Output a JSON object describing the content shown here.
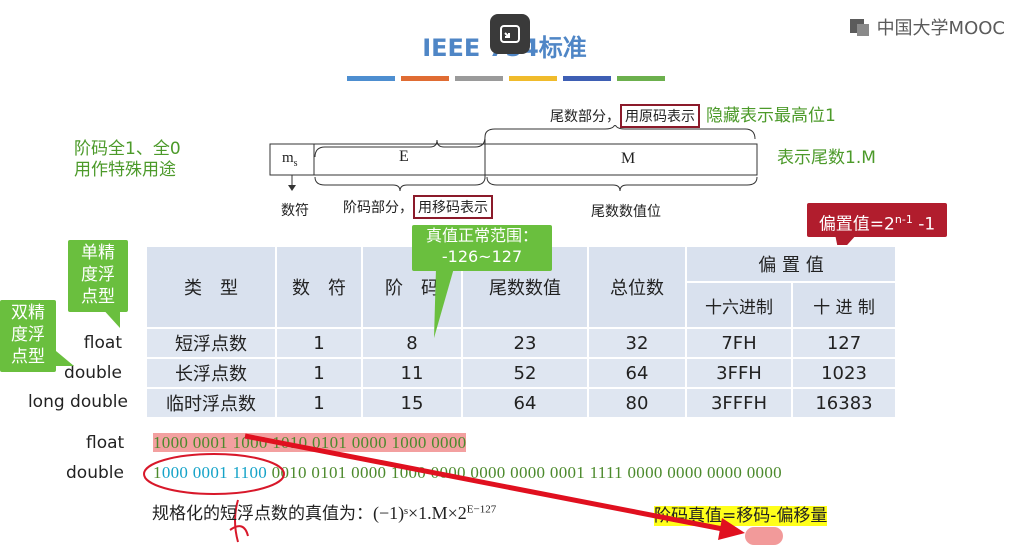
{
  "slide": {
    "title": "IEEE 754标准",
    "brand": "中国大学MOOC",
    "colorbars": [
      "#4d8ed0",
      "#e06c33",
      "#9a9a9a",
      "#f0bb2b",
      "#3e5fb4",
      "#6cb04d"
    ]
  },
  "format_diagram": {
    "top_label_prefix": "尾数部分，",
    "top_label_box": "用原码表示",
    "top_label_suffix": "隐藏表示最高位1",
    "left_note_line1": "阶码全1、全0",
    "left_note_line2": "用作特殊用途",
    "right_note": "表示尾数1.M",
    "field_ms": "m",
    "field_ms_sub": "s",
    "field_e": "E",
    "field_m": "M",
    "below_sign": "数符",
    "below_exp_prefix": "阶码部分，",
    "below_exp_box": "用移码表示",
    "below_mantissa": "尾数数值位"
  },
  "callouts": {
    "single": "单精\n度浮\n点型",
    "double": "双精\n度浮\n点型",
    "exp_range_line1": "真值正常范围：",
    "exp_range_line2": "-126~127",
    "bias": "偏置值=2",
    "bias_sup": "n-1",
    "bias_tail": " -1"
  },
  "table": {
    "headers": {
      "type": "类　型",
      "sign": "数　符",
      "exp": "阶　码",
      "mantissa": "尾数数值",
      "total": "总位数",
      "bias": "偏 置 值",
      "hex": "十六进制",
      "dec": "十 进 制"
    },
    "rows": [
      {
        "label": "float",
        "type": "短浮点数",
        "sign": "1",
        "exp": "8",
        "mantissa": "23",
        "total": "32",
        "hex": "7FH",
        "dec": "127"
      },
      {
        "label": "double",
        "type": "长浮点数",
        "sign": "1",
        "exp": "11",
        "mantissa": "52",
        "total": "64",
        "hex": "3FFH",
        "dec": "1023"
      },
      {
        "label": "long double",
        "type": "临时浮点数",
        "sign": "1",
        "exp": "15",
        "mantissa": "64",
        "total": "80",
        "hex": "3FFFH",
        "dec": "16383"
      }
    ]
  },
  "bits": {
    "float_label": "float",
    "float_bits": "1000 0001 1000 1010 0101 0000 1000 0000",
    "double_label": "double",
    "double_bits_hl": "000 0001 1100",
    "double_bits_lead": "1",
    "double_bits_rest": " 0010 0101 0000 1000 0000 0000 0000 0001 1111 0000 0000 0000 0000"
  },
  "formula": {
    "text": "规格化的短浮点数的真值为：",
    "expr": "(−1)ˢ×1.M×2",
    "expr_sup": "E−127",
    "rule": "阶码真值=移码-偏移量"
  }
}
